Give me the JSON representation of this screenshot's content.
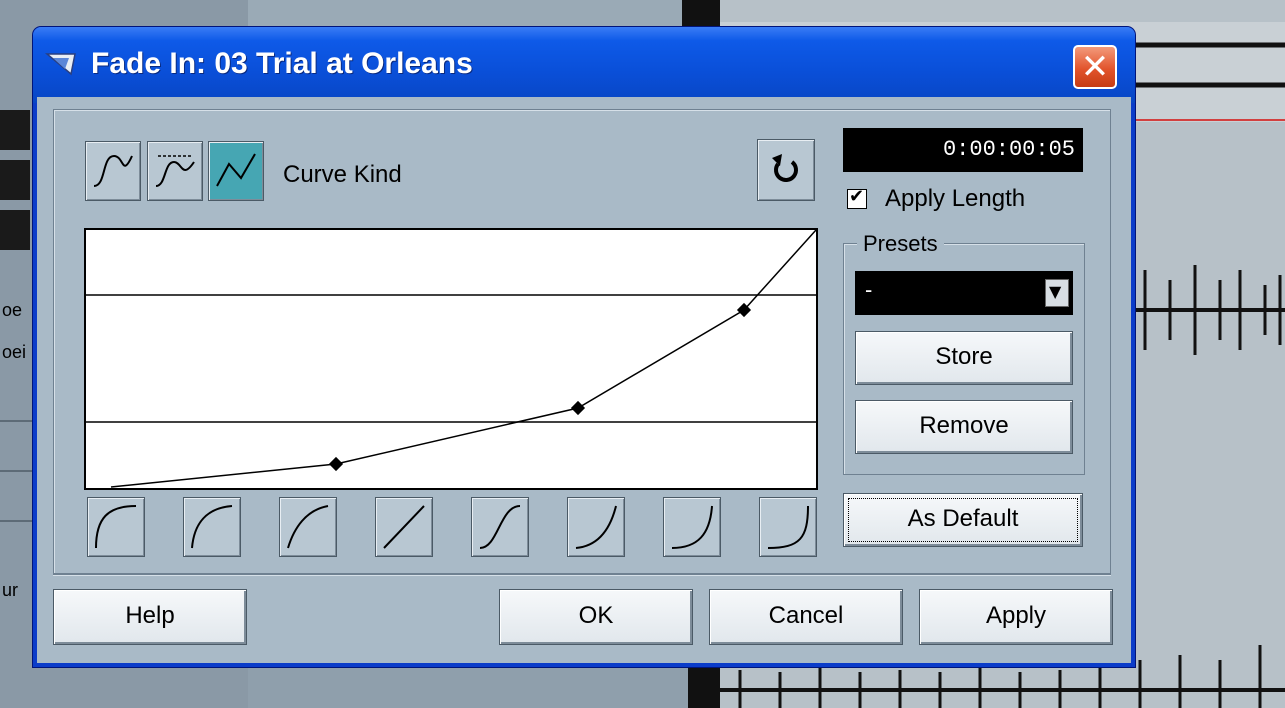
{
  "dialog": {
    "title": "Fade In: 03 Trial at Orleans",
    "close_glyph": "✕"
  },
  "curve_kind": {
    "label": "Curve Kind",
    "buttons": [
      {
        "icon": "spline-curve-icon",
        "active": false
      },
      {
        "icon": "damped-spline-curve-icon",
        "active": false
      },
      {
        "icon": "linear-curve-icon",
        "active": true
      }
    ]
  },
  "length": {
    "time": "0:00:00:05",
    "apply_length_label": "Apply Length",
    "apply_length_checked": true
  },
  "presets": {
    "legend": "Presets",
    "selected": "-",
    "store_label": "Store",
    "remove_label": "Remove"
  },
  "as_default_label": "As Default",
  "footer": {
    "help_label": "Help",
    "ok_label": "OK",
    "cancel_label": "Cancel",
    "apply_label": "Apply"
  },
  "background": {
    "left_labels": [
      "oe",
      "oei",
      "ur"
    ]
  },
  "colors": {
    "title_bar": "#0a4fd8",
    "dialog_body": "#a9bac7",
    "active_button": "#46a6b3",
    "close_button": "#e2542c"
  }
}
